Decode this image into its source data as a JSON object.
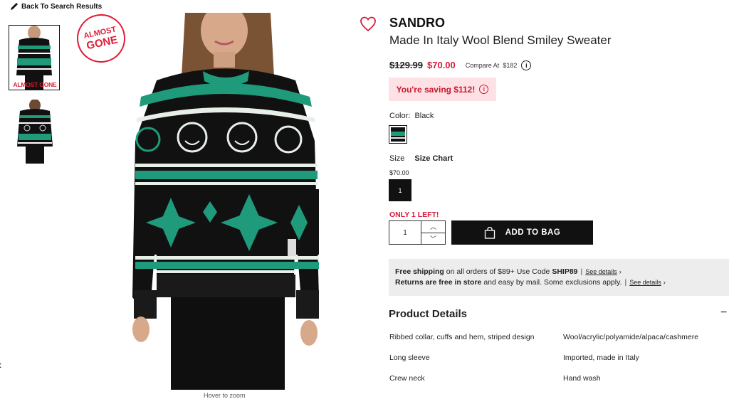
{
  "nav": {
    "back_label": "Back To Search Results"
  },
  "gallery": {
    "badge_line1": "ALMOST",
    "badge_line2": "GONE",
    "thumb_overlay": "ALMOST GONE",
    "zoom_hint": "Hover to zoom"
  },
  "product": {
    "brand": "SANDRO",
    "name": "Made In Italy Wool Blend Smiley Sweater",
    "old_price": "$129.99",
    "price": "$70.00",
    "compare_label": "Compare At",
    "compare_price": "$182",
    "saving": "You're saving $112!",
    "color_label": "Color:",
    "color_value": "Black",
    "size_label": "Size",
    "size_chart": "Size Chart",
    "size_price": "$70.00",
    "size_option": "1",
    "stock_note": "ONLY 1 LEFT!",
    "quantity": "1",
    "add_to_bag": "ADD TO BAG"
  },
  "shipping": {
    "line1_bold": "Free shipping",
    "line1_text": "on all orders of $89+ Use Code",
    "line1_code": "SHIP89",
    "line1_link": "See details",
    "line2_bold": "Returns are free in store",
    "line2_text": "and easy by mail. Some exclusions apply.",
    "line2_link": "See details"
  },
  "details": {
    "title": "Product Details",
    "toggle": "−",
    "left": [
      "Ribbed collar, cuffs and hem, striped design",
      "Long sleeve",
      "Crew neck"
    ],
    "right": [
      "Wool/acrylic/polyamide/alpaca/cashmere",
      "Imported, made in Italy",
      "Hand wash"
    ]
  },
  "colors": {
    "accent_red": "#d61c3a",
    "sweater_green": "#1f9a7a",
    "sweater_black": "#111111",
    "button_black": "#111111",
    "saving_bg": "#fde1e4",
    "shipping_bg": "#ededed"
  }
}
